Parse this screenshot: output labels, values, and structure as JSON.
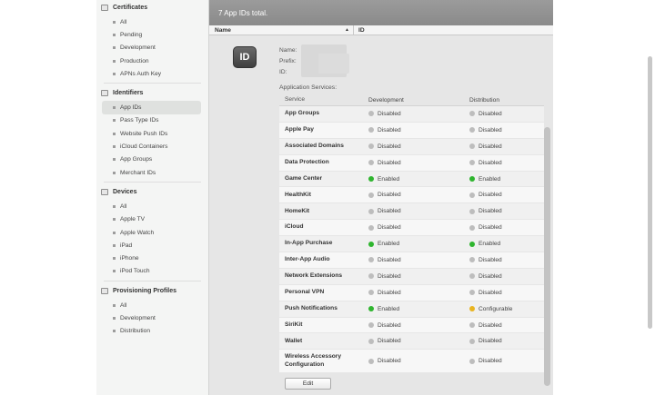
{
  "sidebar": {
    "sections": [
      {
        "title": "Certificates",
        "icon": "certificate-icon",
        "items": [
          "All",
          "Pending",
          "Development",
          "Production",
          "APNs Auth Key"
        ]
      },
      {
        "title": "Identifiers",
        "icon": "identifier-icon",
        "items": [
          "App IDs",
          "Pass Type IDs",
          "Website Push IDs",
          "iCloud Containers",
          "App Groups",
          "Merchant IDs"
        ],
        "selected": "App IDs"
      },
      {
        "title": "Devices",
        "icon": "device-icon",
        "items": [
          "All",
          "Apple TV",
          "Apple Watch",
          "iPad",
          "iPhone",
          "iPod Touch"
        ]
      },
      {
        "title": "Provisioning Profiles",
        "icon": "profile-icon",
        "items": [
          "All",
          "Development",
          "Distribution"
        ]
      }
    ]
  },
  "main": {
    "count_text": "7  App IDs total.",
    "columns": {
      "name": "Name",
      "id": "ID",
      "sort_indicator": "▲"
    },
    "badge": "ID",
    "meta": {
      "name_label": "Name:",
      "prefix_label": "Prefix:",
      "id_label": "ID:"
    },
    "services_title": "Application Services:",
    "services_head": {
      "service": "Service",
      "development": "Development",
      "distribution": "Distribution"
    },
    "services": [
      {
        "name": "App Groups",
        "dev": "Disabled",
        "dist": "Disabled"
      },
      {
        "name": "Apple Pay",
        "dev": "Disabled",
        "dist": "Disabled"
      },
      {
        "name": "Associated Domains",
        "dev": "Disabled",
        "dist": "Disabled"
      },
      {
        "name": "Data Protection",
        "dev": "Disabled",
        "dist": "Disabled"
      },
      {
        "name": "Game Center",
        "dev": "Enabled",
        "dist": "Enabled"
      },
      {
        "name": "HealthKit",
        "dev": "Disabled",
        "dist": "Disabled"
      },
      {
        "name": "HomeKit",
        "dev": "Disabled",
        "dist": "Disabled"
      },
      {
        "name": "iCloud",
        "dev": "Disabled",
        "dist": "Disabled"
      },
      {
        "name": "In-App Purchase",
        "dev": "Enabled",
        "dist": "Enabled"
      },
      {
        "name": "Inter-App Audio",
        "dev": "Disabled",
        "dist": "Disabled"
      },
      {
        "name": "Network Extensions",
        "dev": "Disabled",
        "dist": "Disabled"
      },
      {
        "name": "Personal VPN",
        "dev": "Disabled",
        "dist": "Disabled"
      },
      {
        "name": "Push Notifications",
        "dev": "Enabled",
        "dist": "Configurable"
      },
      {
        "name": "SiriKit",
        "dev": "Disabled",
        "dist": "Disabled"
      },
      {
        "name": "Wallet",
        "dev": "Disabled",
        "dist": "Disabled"
      },
      {
        "name": "Wireless Accessory Configuration",
        "dev": "Disabled",
        "dist": "Disabled"
      }
    ],
    "edit_label": "Edit"
  },
  "colors": {
    "Enabled": "#2fb52f",
    "Disabled": "#bdbdbd",
    "Configurable": "#e9b420"
  }
}
